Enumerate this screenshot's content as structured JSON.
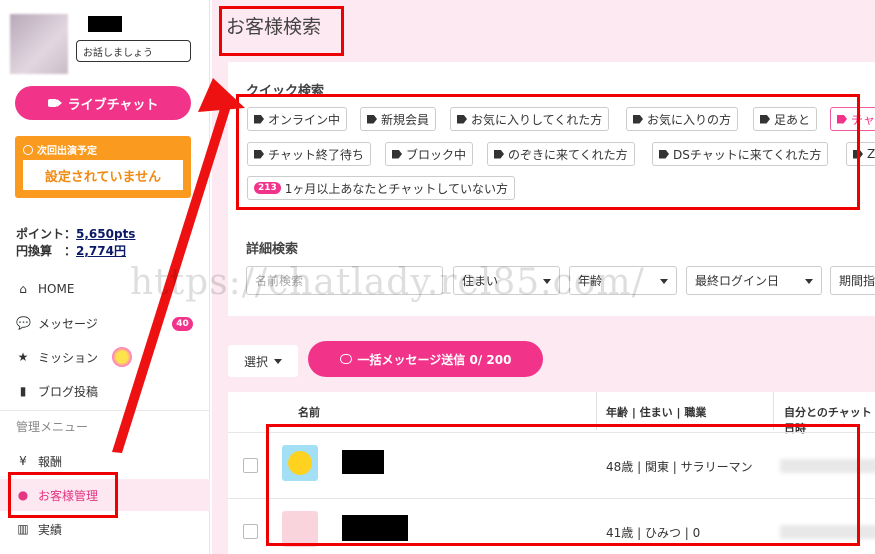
{
  "sidebar": {
    "speech_bubble": "お話しましょう",
    "live_chat_button": "ライブチャット",
    "next_appearance_label": "次回出演予定",
    "next_appearance_value": "設定されていません",
    "points_label": "ポイント：",
    "points_value": "5,650pts",
    "yen_label": "円換算　：",
    "yen_value": "2,774円",
    "nav": [
      {
        "icon": "home-icon",
        "label": "HOME"
      },
      {
        "icon": "message-icon",
        "label": "メッセージ",
        "badge": "40"
      },
      {
        "icon": "star-icon",
        "label": "ミッション"
      },
      {
        "icon": "book-icon",
        "label": "ブログ投稿"
      }
    ],
    "admin_section_label": "管理メニュー",
    "admin_nav": [
      {
        "icon": "yen-icon",
        "label": "報酬"
      },
      {
        "icon": "person-icon",
        "label": "お客様管理"
      },
      {
        "icon": "bar-chart-icon",
        "label": "実績"
      }
    ]
  },
  "main": {
    "page_title": "お客様検索",
    "quick_search": {
      "label": "クイック検索",
      "tags_row1": [
        "オンライン中",
        "新規会員",
        "お気に入りしてくれた方",
        "お気に入りの方",
        "足あと",
        "チャ"
      ],
      "tags_row2": [
        "チャット終了待ち",
        "ブロック中",
        "のぞきに来てくれた方",
        "DSチャットに来てくれた方",
        "Z"
      ],
      "tag_row3_count": "213",
      "tag_row3_label": "1ヶ月以上あなたとチャットしていない方"
    },
    "detail_search": {
      "label": "詳細検索",
      "name_placeholder": "名前検索",
      "residence": "住まい",
      "age": "年齢",
      "last_login": "最終ログイン日",
      "period": "期間指"
    },
    "select_label": "選択",
    "bulk_message_button": "一括メッセージ送信 0/ 200",
    "table": {
      "headers": [
        "名前",
        "年齢 | 住まい | 職業",
        "自分とのチャット日時"
      ],
      "rows": [
        {
          "info": "48歳 | 関東 | サラリーマン"
        },
        {
          "info": "41歳 | ひみつ | 0"
        }
      ]
    }
  },
  "watermark": "https://chatlady.rel85.com/",
  "colors": {
    "accent": "#f2338a",
    "orange": "#fa9a1e",
    "highlight": "#ee0000"
  }
}
